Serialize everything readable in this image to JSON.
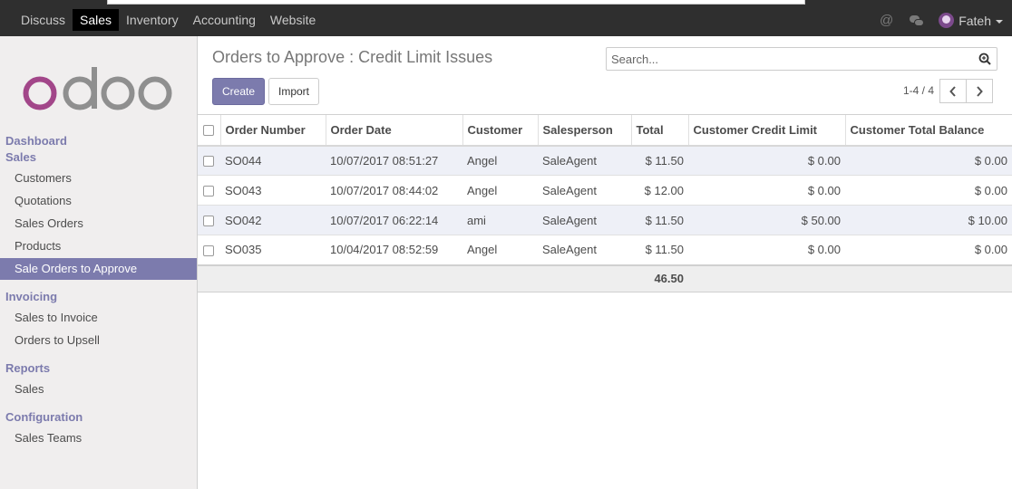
{
  "topbar": {
    "menu": [
      {
        "label": "Discuss",
        "active": false
      },
      {
        "label": "Sales",
        "active": true
      },
      {
        "label": "Inventory",
        "active": false
      },
      {
        "label": "Accounting",
        "active": false
      },
      {
        "label": "Website",
        "active": false
      }
    ],
    "mention_icon": "@",
    "chat_icon": "chat-bubbles-icon",
    "user": "Fateh"
  },
  "sidebar": {
    "logo": "odoo",
    "sections": [
      {
        "heading": "Dashboard"
      },
      {
        "heading": "Sales",
        "items": [
          "Customers",
          "Quotations",
          "Sales Orders",
          "Products",
          "Sale Orders to Approve"
        ]
      },
      {
        "heading": "Invoicing",
        "items": [
          "Sales to Invoice",
          "Orders to Upsell"
        ]
      },
      {
        "heading": "Reports",
        "items": [
          "Sales"
        ]
      },
      {
        "heading": "Configuration",
        "items": [
          "Sales Teams"
        ]
      }
    ],
    "active_item": "Sale Orders to Approve"
  },
  "control": {
    "title": "Orders to Approve : Credit Limit Issues",
    "create_label": "Create",
    "import_label": "Import",
    "search_placeholder": "Search...",
    "pager": "1-4 / 4"
  },
  "table": {
    "columns": [
      "Order Number",
      "Order Date",
      "Customer",
      "Salesperson",
      "Total",
      "Customer Credit Limit",
      "Customer Total Balance"
    ],
    "rows": [
      [
        "SO044",
        "10/07/2017 08:51:27",
        "Angel",
        "SaleAgent",
        "$ 11.50",
        "$ 0.00",
        "$ 0.00"
      ],
      [
        "SO043",
        "10/07/2017 08:44:02",
        "Angel",
        "SaleAgent",
        "$ 12.00",
        "$ 0.00",
        "$ 0.00"
      ],
      [
        "SO042",
        "10/07/2017 06:22:14",
        "ami",
        "SaleAgent",
        "$ 11.50",
        "$ 50.00",
        "$ 10.00"
      ],
      [
        "SO035",
        "10/04/2017 08:52:59",
        "Angel",
        "SaleAgent",
        "$ 11.50",
        "$ 0.00",
        "$ 0.00"
      ]
    ],
    "total_sum": "46.50"
  },
  "colors": {
    "accent": "#7c7bad",
    "topbar": "#2f2f2f",
    "logo_o": "#a24689",
    "logo_doo": "#8f8f8f"
  }
}
